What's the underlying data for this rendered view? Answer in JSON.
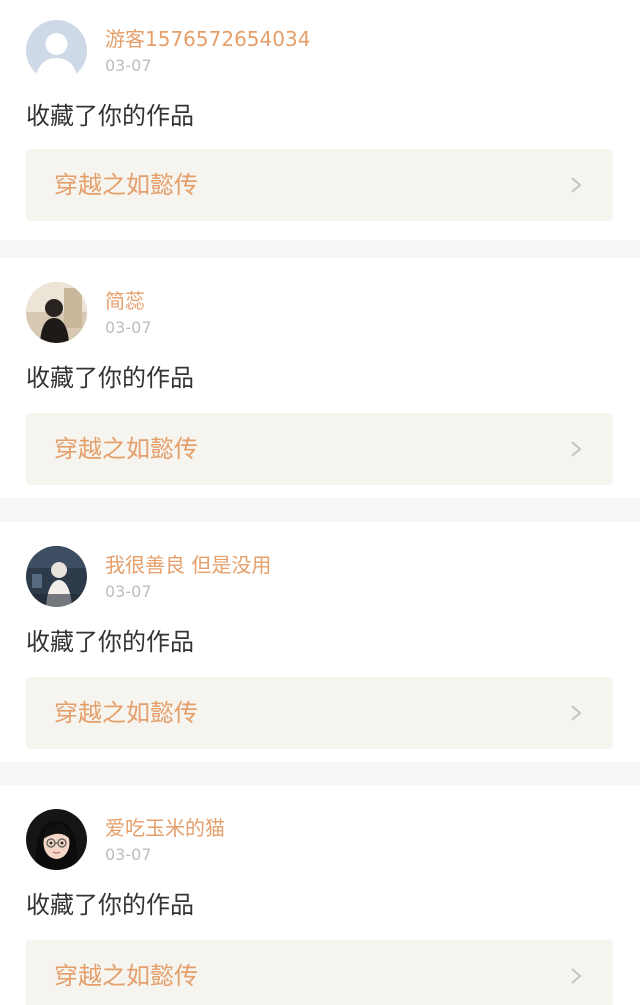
{
  "notifications": [
    {
      "username": "游客1576572654034",
      "date": "03-07",
      "action": "收藏了你的作品",
      "work_title": "穿越之如懿传",
      "avatar_icon": "default-avatar-icon"
    },
    {
      "username": "简蕊",
      "date": "03-07",
      "action": "收藏了你的作品",
      "work_title": "穿越之如懿传",
      "avatar_icon": "photo-avatar"
    },
    {
      "username": "我很善良 但是没用",
      "date": "03-07",
      "action": "收藏了你的作品",
      "work_title": "穿越之如懿传",
      "avatar_icon": "photo-avatar"
    },
    {
      "username": "爱吃玉米的猫",
      "date": "03-07",
      "action": "收藏了你的作品",
      "work_title": "穿越之如懿传",
      "avatar_icon": "cartoon-avatar"
    }
  ],
  "colors": {
    "accent": "#e59f6a",
    "date": "#bdbdbd",
    "text": "#333333",
    "link_bg": "#f5f4ef",
    "page_bg": "#f7f5f5"
  }
}
